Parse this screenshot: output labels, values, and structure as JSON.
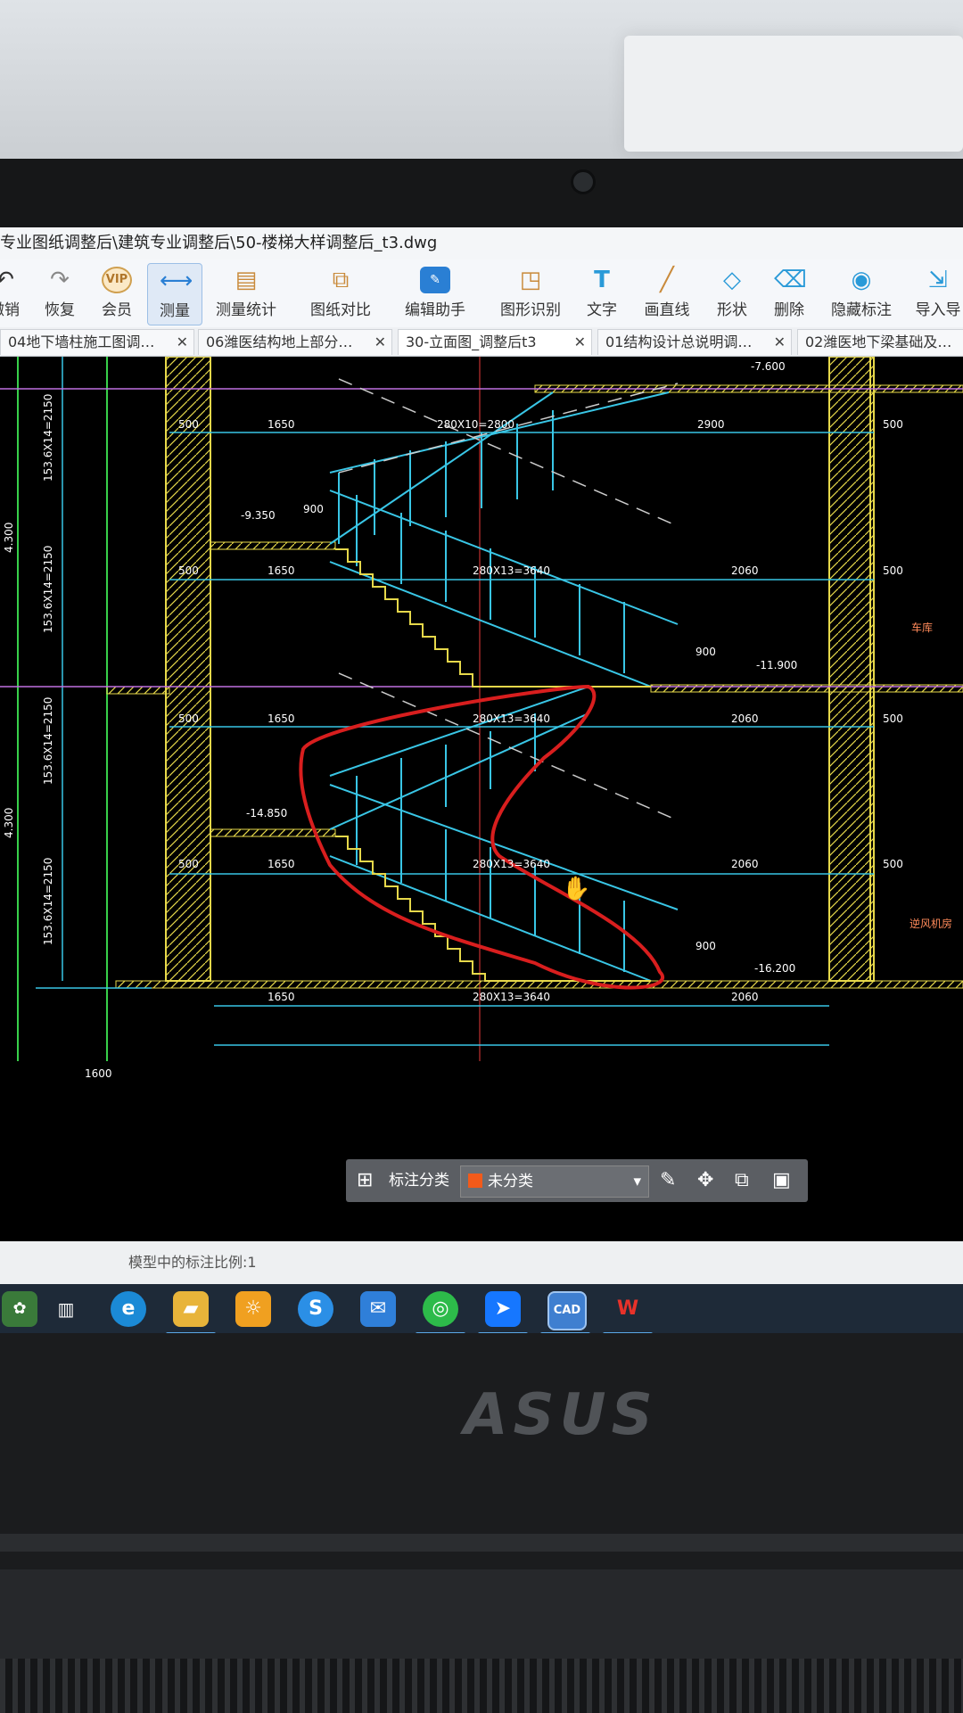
{
  "window": {
    "title": "专业图纸调整后\\建筑专业调整后\\50-楼梯大样调整后_t3.dwg"
  },
  "toolbar": {
    "items": [
      {
        "label": "撤销",
        "icon": "undo-icon"
      },
      {
        "label": "恢复",
        "icon": "redo-icon"
      },
      {
        "label": "会员",
        "icon": "vip-icon",
        "badge": "VIP"
      },
      {
        "label": "测量",
        "icon": "ruler-icon"
      },
      {
        "label": "测量统计",
        "icon": "measure-stats-icon"
      },
      {
        "label": "图纸对比",
        "icon": "compare-icon"
      },
      {
        "label": "编辑助手",
        "icon": "edit-assistant-icon"
      },
      {
        "label": "图形识别",
        "icon": "shape-recognition-icon"
      },
      {
        "label": "文字",
        "icon": "text-icon",
        "glyph": "T"
      },
      {
        "label": "画直线",
        "icon": "line-icon"
      },
      {
        "label": "形状",
        "icon": "shape-icon"
      },
      {
        "label": "删除",
        "icon": "eraser-icon"
      },
      {
        "label": "隐藏标注",
        "icon": "eye-hide-icon"
      },
      {
        "label": "导入导",
        "icon": "import-icon"
      }
    ]
  },
  "tabs": [
    {
      "label": "04地下墙柱施工图调…"
    },
    {
      "label": "06潍医结构地上部分…"
    },
    {
      "label": "30-立面图_调整后t3"
    },
    {
      "label": "01结构设计总说明调…"
    },
    {
      "label": "02潍医地下梁基础及…"
    }
  ],
  "drawing": {
    "elevations": [
      "-7.600",
      "-9.350",
      "-11.900",
      "-14.850",
      "-16.200"
    ],
    "dims_left": [
      "1650",
      "1650",
      "1650",
      "1650",
      "1650"
    ],
    "dims_flight": [
      "280X10=2800",
      "280X13=3640",
      "280X13=3640",
      "280X13=3640",
      "280X13=3640"
    ],
    "dims_right": [
      "2900",
      "2060",
      "2060",
      "2060",
      "2060"
    ],
    "side500": "500",
    "rail900": "900",
    "vertical_dims": [
      "153.6X14=2150",
      "153.6X14=2150",
      "153.6X14=2150",
      "153.6X14=2150"
    ],
    "left_heights": [
      "4.300",
      "4.300"
    ],
    "bottom_left_dim": "1600",
    "room_label_1": "车库",
    "room_label_2": "逆风机房",
    "markup_color": "#d81e1e",
    "cyan": "#39c6e6",
    "yellow": "#e6d84a"
  },
  "annotation_bar": {
    "label": "标注分类",
    "selected": "未分类",
    "swatch_color": "#f25a1a"
  },
  "status": {
    "text": "模型中的标注比例:1"
  },
  "taskbar": {
    "apps": [
      "task-view-icon",
      "edge-icon",
      "file-explorer-icon",
      "sunlogin-icon",
      "sogou-icon",
      "mail-icon",
      "wechat-icon",
      "dingtalk-icon",
      "cad-icon",
      "wps-icon"
    ],
    "cad_label": "CAD",
    "wps_label": "W"
  },
  "device": {
    "brand": "ASUS"
  }
}
